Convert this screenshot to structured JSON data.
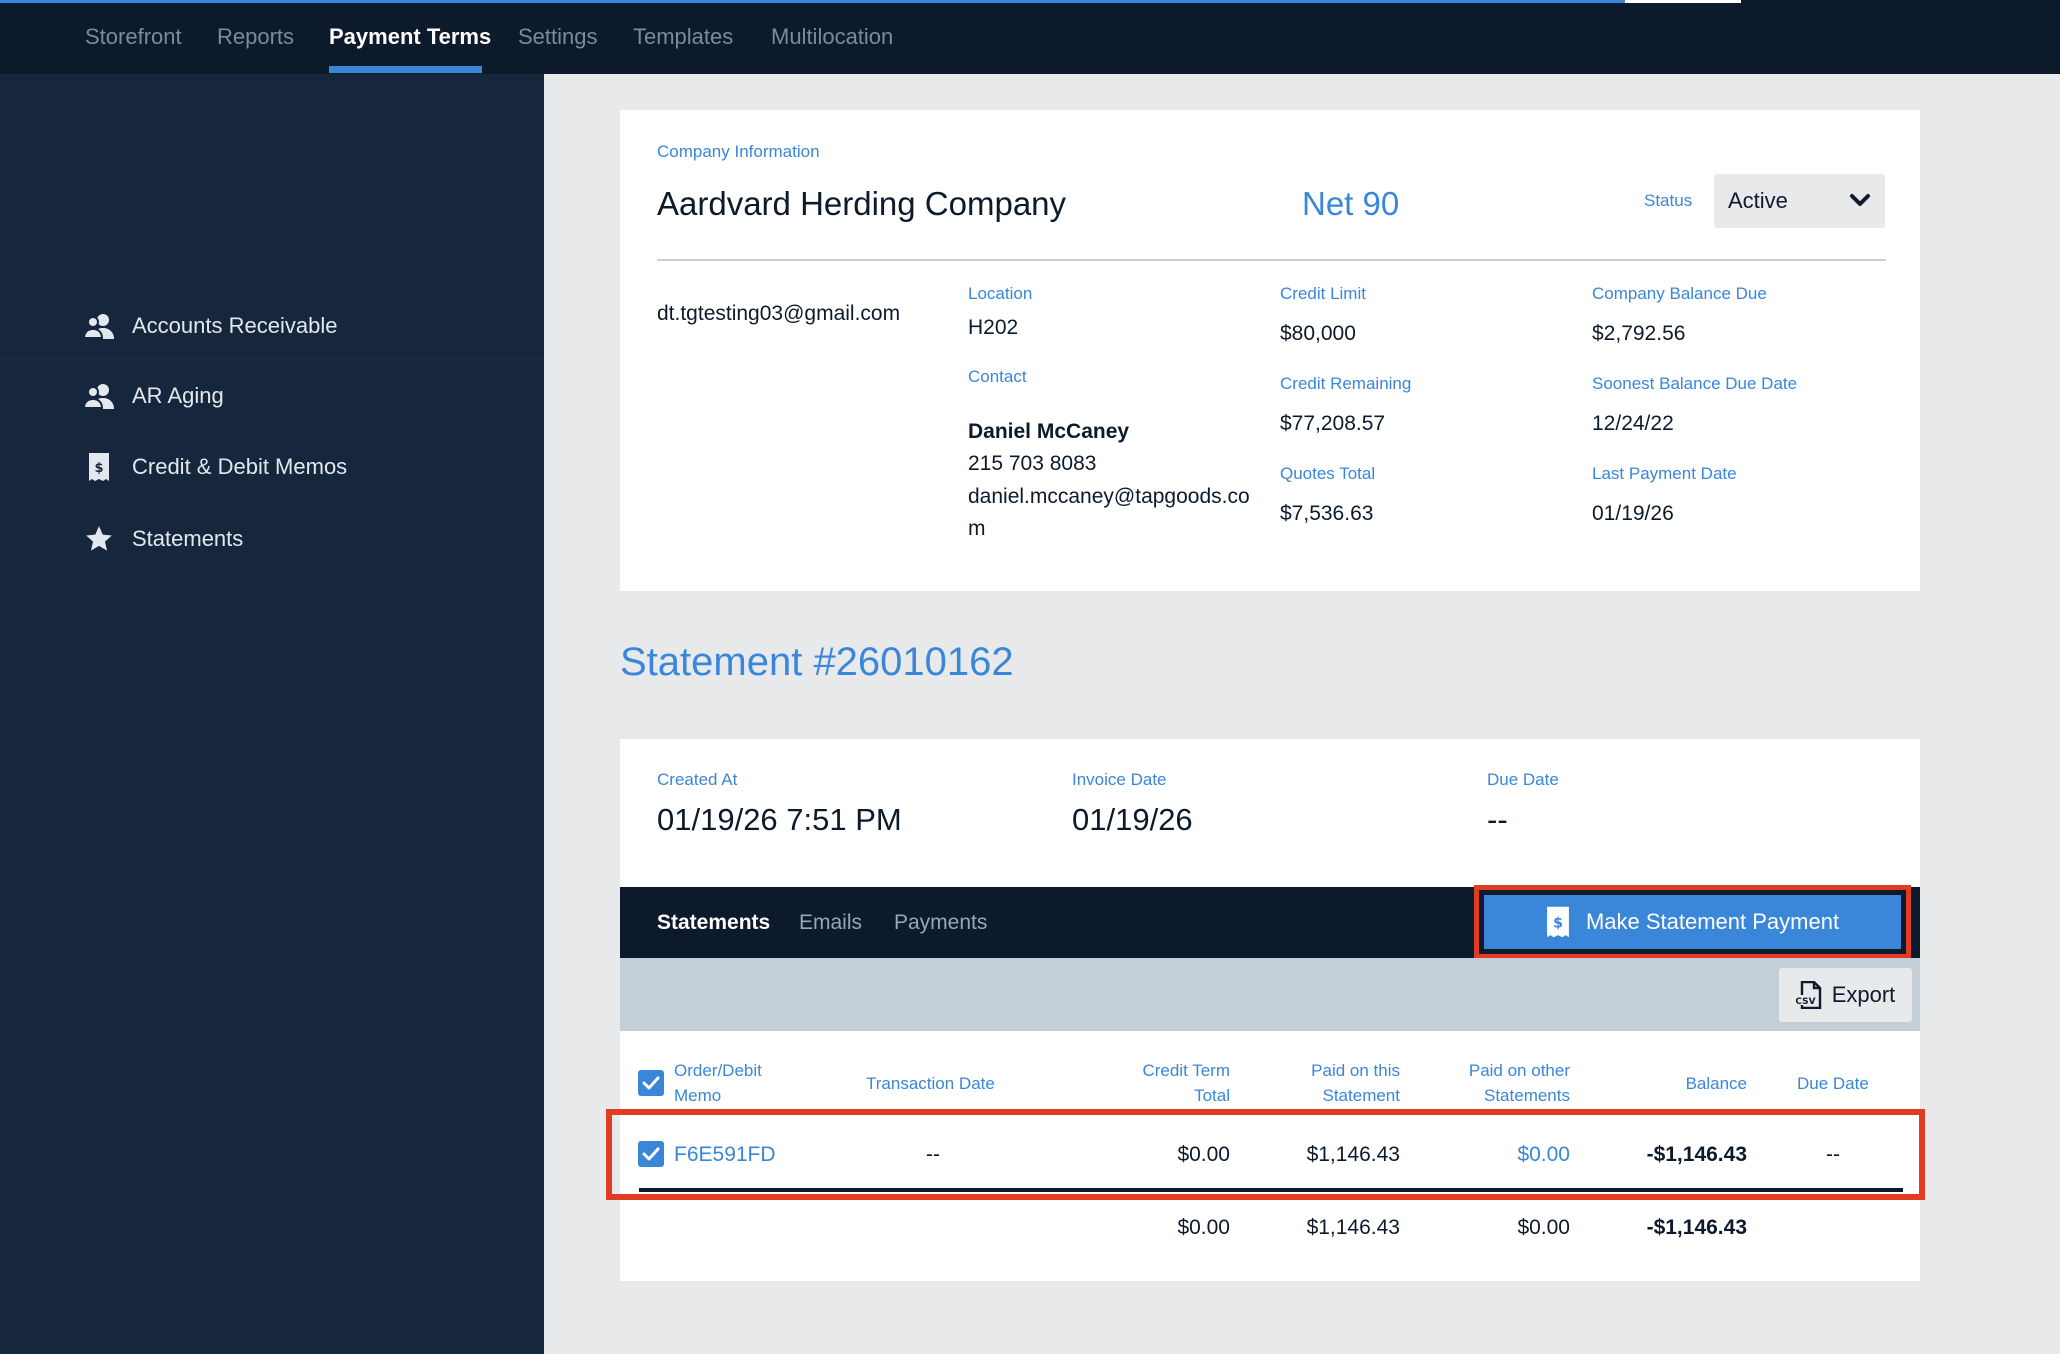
{
  "topnav": {
    "tabs": [
      "Storefront",
      "Reports",
      "Payment Terms",
      "Settings",
      "Templates",
      "Multilocation"
    ],
    "active": "Payment Terms"
  },
  "sidebar": {
    "items": [
      {
        "label": "Accounts Receivable",
        "icon": "users-icon"
      },
      {
        "label": "AR Aging",
        "icon": "users-icon"
      },
      {
        "label": "Credit & Debit Memos",
        "icon": "receipt-icon"
      },
      {
        "label": "Statements",
        "icon": "star-icon"
      }
    ]
  },
  "company": {
    "section_label": "Company Information",
    "name": "Aardvard Herding Company",
    "terms": "Net 90",
    "status_label": "Status",
    "status_value": "Active",
    "email": "dt.tgtesting03@gmail.com",
    "location_label": "Location",
    "location": "H202",
    "contact_label": "Contact",
    "contact_name": "Daniel McCaney",
    "contact_phone": "215 703 8083",
    "contact_email_line1": "daniel.mccaney@tapgoods.co",
    "contact_email_line2": "m",
    "credit_limit_label": "Credit Limit",
    "credit_limit": "$80,000",
    "credit_remaining_label": "Credit Remaining",
    "credit_remaining": "$77,208.57",
    "quotes_total_label": "Quotes Total",
    "quotes_total": "$7,536.63",
    "balance_due_label": "Company Balance Due",
    "balance_due": "$2,792.56",
    "soonest_due_label": "Soonest Balance Due Date",
    "soonest_due": "12/24/22",
    "last_payment_label": "Last Payment Date",
    "last_payment": "01/19/26"
  },
  "statement": {
    "title": "Statement #26010162",
    "created_label": "Created At",
    "created": "01/19/26 7:51 PM",
    "invoice_label": "Invoice Date",
    "invoice": "01/19/26",
    "due_label": "Due Date",
    "due": "--"
  },
  "tabs": {
    "items": [
      "Statements",
      "Emails",
      "Payments"
    ],
    "active": "Statements",
    "pay_button": "Make Statement Payment",
    "export_button": "Export"
  },
  "table": {
    "headers": {
      "order_l1": "Order/Debit",
      "order_l2": "Memo",
      "transaction_date": "Transaction Date",
      "credit_l1": "Credit Term",
      "credit_l2": "Total",
      "paid_this_l1": "Paid on this",
      "paid_this_l2": "Statement",
      "paid_other_l1": "Paid on other",
      "paid_other_l2": "Statements",
      "balance": "Balance",
      "due_date": "Due Date"
    },
    "row": {
      "order": "F6E591FD",
      "transaction_date": "--",
      "credit_total": "$0.00",
      "paid_this": "$1,146.43",
      "paid_other": "$0.00",
      "balance": "-$1,146.43",
      "due_date": "--"
    },
    "totals": {
      "credit_total": "$0.00",
      "paid_this": "$1,146.43",
      "paid_other": "$0.00",
      "balance": "-$1,146.43"
    }
  }
}
